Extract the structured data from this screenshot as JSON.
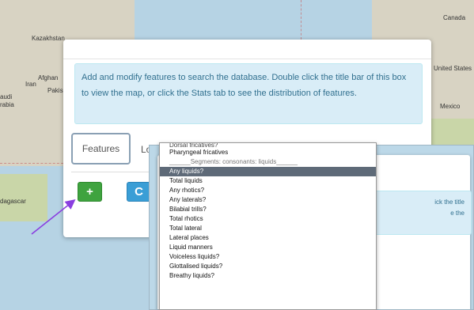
{
  "map": {
    "labels": [
      "Canada",
      "Kazakhstan",
      "United States",
      "Afghan",
      "Iran",
      "Pakis",
      "audi",
      "rabia",
      "Mexico",
      "dagascar"
    ]
  },
  "panel": {
    "info_text": "Add and modify features to search the database. Double click the title bar of this box to view the map, or click the Stats tab to see the distribution of features.",
    "tabs": [
      "Features",
      "Lo"
    ],
    "add_button_icon": "+",
    "refresh_button_icon": "C"
  },
  "inset": {
    "info_right_1": "ick the title",
    "info_right_2": "e the"
  },
  "dropdown": {
    "items": [
      {
        "label": "Dorsal fricatives?",
        "partial": true
      },
      {
        "label": "Pharyngeal fricatives"
      },
      {
        "label": "______Segments: consonants: liquids______",
        "group": true
      },
      {
        "label": "Any liquids?",
        "selected": true
      },
      {
        "label": "Total liquids"
      },
      {
        "label": "Any rhotics?"
      },
      {
        "label": "Any laterals?"
      },
      {
        "label": "Bilabial trills?"
      },
      {
        "label": "Total rhotics"
      },
      {
        "label": "Total lateral"
      },
      {
        "label": "Lateral places"
      },
      {
        "label": "Liquid manners"
      },
      {
        "label": "Voiceless liquids?"
      },
      {
        "label": "Glottalised liquids?"
      },
      {
        "label": "Breathy liquids?"
      }
    ]
  },
  "colors": {
    "accent_arrow": "#8a3fe0",
    "add_green": "#3fa33f",
    "refresh_blue": "#3a9ed6",
    "selected_bg": "#5e6a78"
  }
}
